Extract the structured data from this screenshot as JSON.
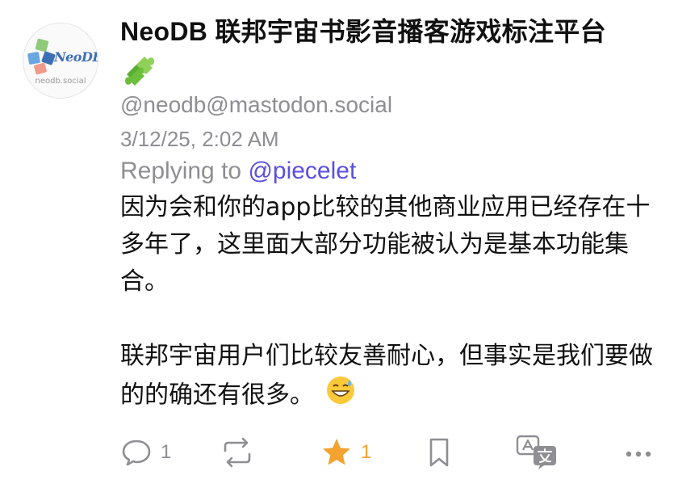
{
  "avatar": {
    "logo_text": "NeoDB",
    "logo_sub": "neodb.social"
  },
  "post": {
    "display_name": "NeoDB 联邦宇宙书影音播客游戏标注平台",
    "name_emoji": "puzzle-piece-icon",
    "handle": "@neodb@mastodon.social",
    "timestamp": "3/12/25, 2:02 AM",
    "replying_prefix": "Replying to ",
    "replying_mention": "@piecelet",
    "paragraphs": [
      "因为会和你的app比较的其他商业应用已经存在十多年了，这里面大部分功能被认为是基本功能集合。",
      "联邦宇宙用户们比较友善耐心，但事实是我们要做的的确还有很多。"
    ],
    "trailing_emoji": "grinning-sweat-emoji"
  },
  "actions": {
    "reply_count": "1",
    "favourite_count": "1",
    "colors": {
      "muted": "#8e8e93",
      "favourite": "#f4a230",
      "mention": "#5b4fe0"
    },
    "icons": [
      "reply-icon",
      "boost-icon",
      "star-icon",
      "bookmark-icon",
      "translate-icon",
      "more-icon"
    ]
  }
}
